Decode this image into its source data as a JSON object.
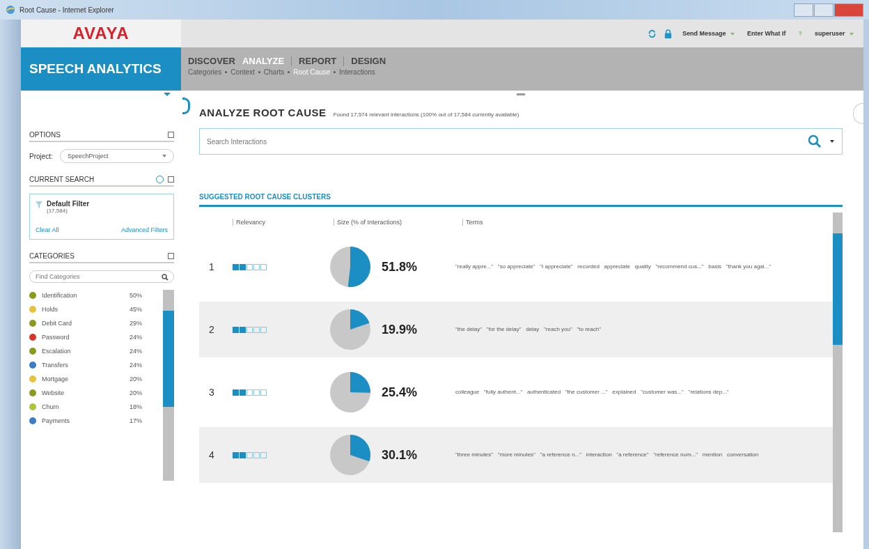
{
  "window": {
    "title": "Root Cause - Internet Explorer"
  },
  "brand": {
    "logo": "AVAYA",
    "product": "SPEECH ANALYTICS"
  },
  "toolbar": {
    "send_message": "Send Message",
    "what_if": "Enter What If",
    "help": "?",
    "user": "superuser"
  },
  "tabs": [
    {
      "label": "DISCOVER",
      "selected": false
    },
    {
      "label": "ANALYZE",
      "selected": true
    },
    {
      "label": "REPORT",
      "selected": false
    },
    {
      "label": "DESIGN",
      "selected": false
    }
  ],
  "subtabs": [
    {
      "label": "Categories",
      "selected": false
    },
    {
      "label": "Context",
      "selected": false
    },
    {
      "label": "Charts",
      "selected": false
    },
    {
      "label": "Root Cause",
      "selected": true
    },
    {
      "label": "Interactions",
      "selected": false
    }
  ],
  "sidebar": {
    "options_title": "OPTIONS",
    "project_label": "Project:",
    "project_value": "SpeechProject",
    "current_search_title": "CURRENT SEARCH",
    "filter_name": "Default Filter",
    "filter_count": "(17,584)",
    "clear_all": "Clear All",
    "advanced_filters": "Advanced Filters",
    "categories_title": "CATEGORIES",
    "categories_placeholder": "Find Categories",
    "categories": [
      {
        "name": "Identification",
        "percent": "50%",
        "color": "#8a9a1c"
      },
      {
        "name": "Holds",
        "percent": "45%",
        "color": "#e8c23a"
      },
      {
        "name": "Debit Card",
        "percent": "29%",
        "color": "#8a9a1c"
      },
      {
        "name": "Password",
        "percent": "24%",
        "color": "#d9342b"
      },
      {
        "name": "Escalation",
        "percent": "24%",
        "color": "#8a9a1c"
      },
      {
        "name": "Transfers",
        "percent": "24%",
        "color": "#3a7cc7"
      },
      {
        "name": "Mortgage",
        "percent": "20%",
        "color": "#e8c23a"
      },
      {
        "name": "Website",
        "percent": "20%",
        "color": "#8a9a1c"
      },
      {
        "name": "Churn",
        "percent": "18%",
        "color": "#a8c83a"
      },
      {
        "name": "Payments",
        "percent": "17%",
        "color": "#3a7cc7"
      }
    ]
  },
  "main": {
    "title": "ANALYZE ROOT CAUSE",
    "subtitle": "Found 17,574 relevant interactions (100% out of 17,584 currently available)",
    "search_placeholder": "Search Interactions",
    "section_title": "SUGGESTED ROOT CAUSE CLUSTERS",
    "columns": [
      "Relevancy",
      "Size (% of Interactions)",
      "Terms"
    ],
    "rows": [
      {
        "rank": "1",
        "stars": 2,
        "size": "51.8%",
        "terms": "\"really appre...\"   \"so appreciate\"   \"I appreciate\"   recorded   appreciate   quality   \"recommend cus...\"   basis   \"thank you agai...\""
      },
      {
        "rank": "2",
        "stars": 2,
        "size": "19.9%",
        "terms": "\"the delay\"   \"for the delay\"   delay   \"reach you\"   \"to reach\""
      },
      {
        "rank": "3",
        "stars": 2,
        "size": "25.4%",
        "terms": "colleague   \"fully authent...\"   authenticated   \"the customer ...\"   explained   \"customer was...\"   \"relations dep...\""
      },
      {
        "rank": "4",
        "stars": 2,
        "size": "30.1%",
        "terms": "\"three minutes\"   \"more minutes\"   \"a reference n...\"   interaction   \"a reference\"   \"reference num...\"   mention   conversation"
      }
    ]
  }
}
